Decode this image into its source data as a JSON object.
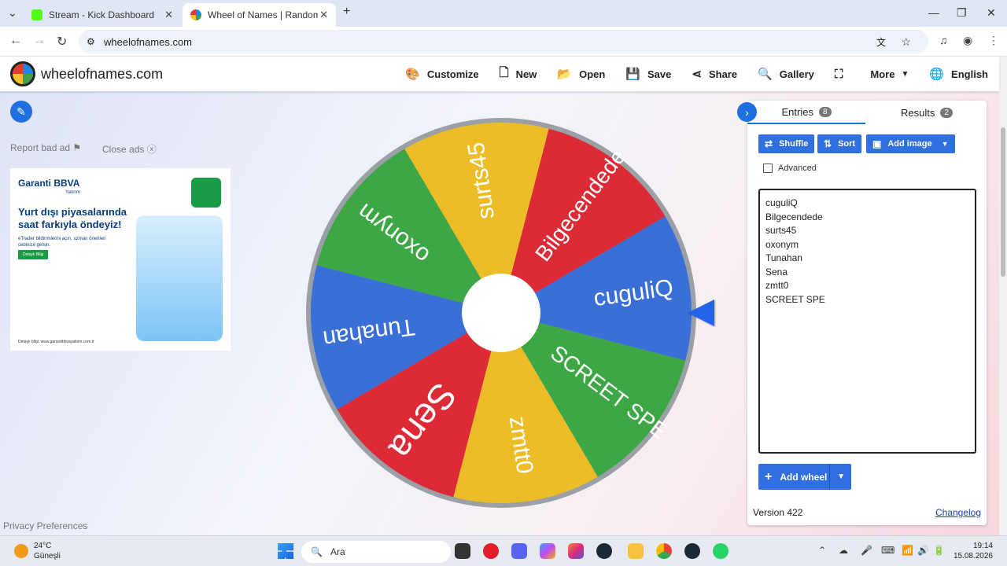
{
  "browser": {
    "tabs": [
      {
        "title": "Stream - Kick Dashboard",
        "active": false
      },
      {
        "title": "Wheel of Names | Random nam",
        "active": true
      }
    ],
    "new_tab": "+",
    "url": "wheelofnames.com"
  },
  "header": {
    "site_name": "wheelofnames.com",
    "menu": {
      "customize": "Customize",
      "new": "New",
      "open": "Open",
      "save": "Save",
      "share": "Share",
      "gallery": "Gallery",
      "more": "More",
      "language": "English"
    }
  },
  "ads": {
    "report": "Report bad ad",
    "close": "Close ads",
    "brand": "Garanti BBVA",
    "brand_sub": "Yatırım",
    "headline": "Yurt dışı piyasalarında saat farkıyla öndeyiz!",
    "sub": "eTrader bildirimlerini açın, uzman önerileri cebinize gelsin.",
    "cta": "Detaylı Bilgi",
    "footer": "Detaylı bilgi: www.garantibbvayatirim.com.tr"
  },
  "wheel": {
    "segments": [
      {
        "label": "cuguliQ",
        "color": "#3b6fd8"
      },
      {
        "label": "Bilgecendede",
        "color": "#dc2b36"
      },
      {
        "label": "surts45",
        "color": "#edbd28"
      },
      {
        "label": "oxonym",
        "color": "#3ea745"
      },
      {
        "label": "Tunahan",
        "color": "#3b6fd8"
      },
      {
        "label": "Sena",
        "color": "#dc2b36"
      },
      {
        "label": "zmtt0",
        "color": "#edbd28"
      },
      {
        "label": "SCREET SPE",
        "color": "#3ea745"
      }
    ]
  },
  "panel": {
    "tabs": {
      "entries": "Entries",
      "entries_count": "8",
      "results": "Results",
      "results_count": "2"
    },
    "buttons": {
      "shuffle": "Shuffle",
      "sort": "Sort",
      "add_image": "Add image"
    },
    "advanced": "Advanced",
    "entries": [
      "cuguliQ",
      "Bilgecendede",
      "surts45",
      "oxonym",
      "Tunahan",
      "Sena",
      "zmtt0",
      "SCREET SPE"
    ],
    "add_wheel": "Add wheel",
    "version": "Version 422",
    "changelog": "Changelog"
  },
  "footer": {
    "privacy": "Privacy Preferences"
  },
  "taskbar": {
    "temp": "24°C",
    "weather": "Güneşli",
    "search": "Ara",
    "time": "19:14",
    "date": "15.08.2026"
  }
}
